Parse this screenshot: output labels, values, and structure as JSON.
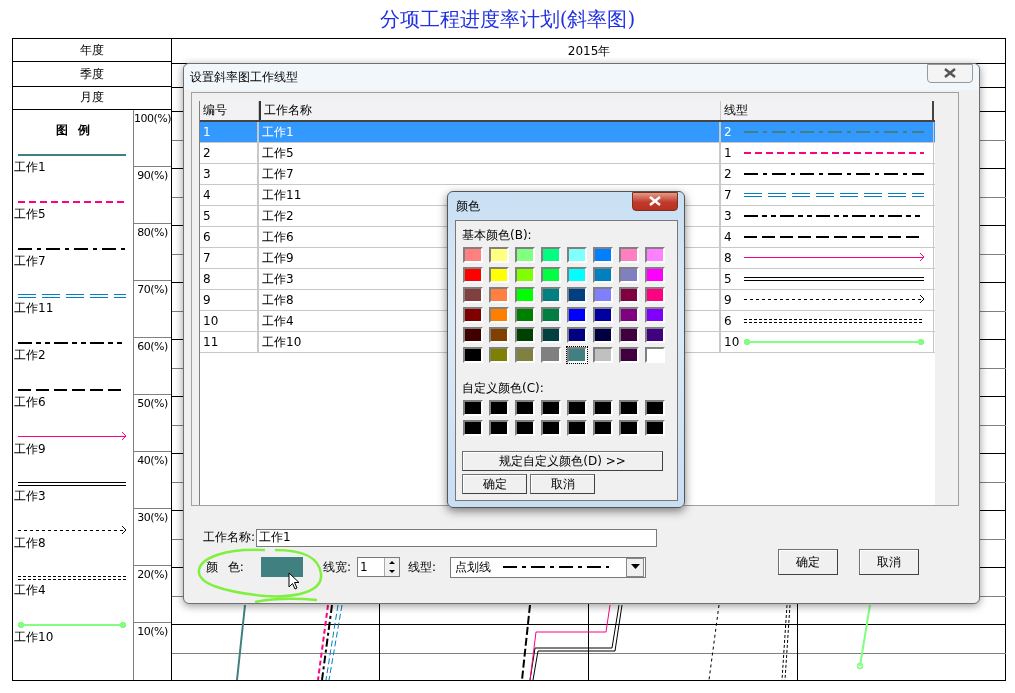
{
  "title": "分项工程进度率计划(斜率图)",
  "header_rows": [
    {
      "label": "年度",
      "value": "2015年"
    },
    {
      "label": "季度"
    },
    {
      "label": "月度"
    }
  ],
  "legend": {
    "heading": "图 例",
    "items": [
      {
        "label": "工作1",
        "kind": "solid",
        "color": "#408080"
      },
      {
        "label": "工作5",
        "kind": "dashed",
        "color": "#ff0080"
      },
      {
        "label": "工作7",
        "kind": "dash-dot",
        "color": "#000000"
      },
      {
        "label": "工作11",
        "kind": "double-dashed",
        "color": "#0080c0"
      },
      {
        "label": "工作2",
        "kind": "dash-dot-dot",
        "color": "#000000"
      },
      {
        "label": "工作6",
        "kind": "long-dash",
        "color": "#000000"
      },
      {
        "label": "工作9",
        "kind": "arrow",
        "color": "#ff0080"
      },
      {
        "label": "工作3",
        "kind": "double",
        "color": "#000000"
      },
      {
        "label": "工作8",
        "kind": "dotted-arrow",
        "color": "#000000"
      },
      {
        "label": "工作4",
        "kind": "double-dotted",
        "color": "#000000"
      },
      {
        "label": "工作10",
        "kind": "circle-ends",
        "color": "#80ff80"
      }
    ]
  },
  "scale": [
    "100(%)",
    "90(%)",
    "80(%)",
    "70(%)",
    "60(%)",
    "50(%)",
    "40(%)",
    "30(%)",
    "20(%)",
    "10(%)"
  ],
  "dialog": {
    "title": "设置斜率图工作线型",
    "columns": [
      "编号",
      "工作名称",
      "线型"
    ],
    "rows": [
      {
        "number": "1",
        "name": "工作1",
        "line_type": "2",
        "kind": "dash-dot",
        "color": "#408080",
        "selected": true
      },
      {
        "number": "2",
        "name": "工作5",
        "line_type": "1",
        "kind": "dashed",
        "color": "#ff0080",
        "selected": false
      },
      {
        "number": "3",
        "name": "工作7",
        "line_type": "2",
        "kind": "dash-dot",
        "color": "#000000",
        "selected": false
      },
      {
        "number": "4",
        "name": "工作11",
        "line_type": "7",
        "kind": "double-dashed",
        "color": "#0080c0",
        "selected": false
      },
      {
        "number": "5",
        "name": "工作2",
        "line_type": "3",
        "kind": "dash-dot-dot",
        "color": "#000000",
        "selected": false
      },
      {
        "number": "6",
        "name": "工作6",
        "line_type": "4",
        "kind": "long-dash",
        "color": "#000000",
        "selected": false
      },
      {
        "number": "7",
        "name": "工作9",
        "line_type": "8",
        "kind": "arrow",
        "color": "#ff0080",
        "selected": false
      },
      {
        "number": "8",
        "name": "工作3",
        "line_type": "5",
        "kind": "double",
        "color": "#000000",
        "selected": false
      },
      {
        "number": "9",
        "name": "工作8",
        "line_type": "9",
        "kind": "dotted-arrow",
        "color": "#000000",
        "selected": false
      },
      {
        "number": "10",
        "name": "工作4",
        "line_type": "6",
        "kind": "double-dotted",
        "color": "#000000",
        "selected": false
      },
      {
        "number": "11",
        "name": "工作10",
        "line_type": "10",
        "kind": "circle-ends",
        "color": "#80ff80",
        "selected": false
      }
    ],
    "name_label": "工作名称:",
    "name_value": "工作1",
    "color_label": "颜 色:",
    "color": "#408080",
    "width_label": "线宽:",
    "width_value": "1",
    "type_label": "线型:",
    "type_value": "点划线",
    "type_line": {
      "kind": "dash-dot"
    },
    "buttons": [
      "确定",
      "取消"
    ]
  },
  "color_dialog": {
    "title": "颜色",
    "basic_label": "基本颜色(B):",
    "basic_colors": [
      {
        "color": "#ff8080",
        "selected": false
      },
      {
        "color": "#ffff80",
        "selected": false
      },
      {
        "color": "#80ff80",
        "selected": false
      },
      {
        "color": "#00ff80",
        "selected": false
      },
      {
        "color": "#80ffff",
        "selected": false
      },
      {
        "color": "#0080ff",
        "selected": false
      },
      {
        "color": "#ff80c0",
        "selected": false
      },
      {
        "color": "#ff80ff",
        "selected": false
      },
      {
        "color": "#ff0000",
        "selected": false
      },
      {
        "color": "#ffff00",
        "selected": false
      },
      {
        "color": "#80ff00",
        "selected": false
      },
      {
        "color": "#00ff40",
        "selected": false
      },
      {
        "color": "#00ffff",
        "selected": false
      },
      {
        "color": "#0080c0",
        "selected": false
      },
      {
        "color": "#8080c0",
        "selected": false
      },
      {
        "color": "#ff00ff",
        "selected": false
      },
      {
        "color": "#804040",
        "selected": false
      },
      {
        "color": "#ff8040",
        "selected": false
      },
      {
        "color": "#00ff00",
        "selected": false
      },
      {
        "color": "#008080",
        "selected": false
      },
      {
        "color": "#004080",
        "selected": false
      },
      {
        "color": "#8080ff",
        "selected": false
      },
      {
        "color": "#800040",
        "selected": false
      },
      {
        "color": "#ff0080",
        "selected": false
      },
      {
        "color": "#800000",
        "selected": false
      },
      {
        "color": "#ff8000",
        "selected": false
      },
      {
        "color": "#008000",
        "selected": false
      },
      {
        "color": "#008040",
        "selected": false
      },
      {
        "color": "#0000ff",
        "selected": false
      },
      {
        "color": "#0000a0",
        "selected": false
      },
      {
        "color": "#800080",
        "selected": false
      },
      {
        "color": "#8000ff",
        "selected": false
      },
      {
        "color": "#400000",
        "selected": false
      },
      {
        "color": "#804000",
        "selected": false
      },
      {
        "color": "#004000",
        "selected": false
      },
      {
        "color": "#004040",
        "selected": false
      },
      {
        "color": "#000080",
        "selected": false
      },
      {
        "color": "#000040",
        "selected": false
      },
      {
        "color": "#400040",
        "selected": false
      },
      {
        "color": "#400080",
        "selected": false
      },
      {
        "color": "#000000",
        "selected": false
      },
      {
        "color": "#808000",
        "selected": false
      },
      {
        "color": "#808040",
        "selected": false
      },
      {
        "color": "#808080",
        "selected": false
      },
      {
        "color": "#408080",
        "selected": true
      },
      {
        "color": "#c0c0c0",
        "selected": false
      },
      {
        "color": "#400040",
        "selected": false
      },
      {
        "color": "#ffffff",
        "selected": false
      }
    ],
    "custom_label": "自定义颜色(C):",
    "custom_colors": [
      {
        "color": "#000000"
      },
      {
        "color": "#000000"
      },
      {
        "color": "#000000"
      },
      {
        "color": "#000000"
      },
      {
        "color": "#000000"
      },
      {
        "color": "#000000"
      },
      {
        "color": "#000000"
      },
      {
        "color": "#000000"
      },
      {
        "color": "#000000"
      },
      {
        "color": "#000000"
      },
      {
        "color": "#000000"
      },
      {
        "color": "#000000"
      },
      {
        "color": "#000000"
      },
      {
        "color": "#000000"
      },
      {
        "color": "#000000"
      },
      {
        "color": "#000000"
      }
    ],
    "define_button": "规定自定义颜色(D) >>",
    "buttons": [
      "确定",
      "取消"
    ]
  }
}
